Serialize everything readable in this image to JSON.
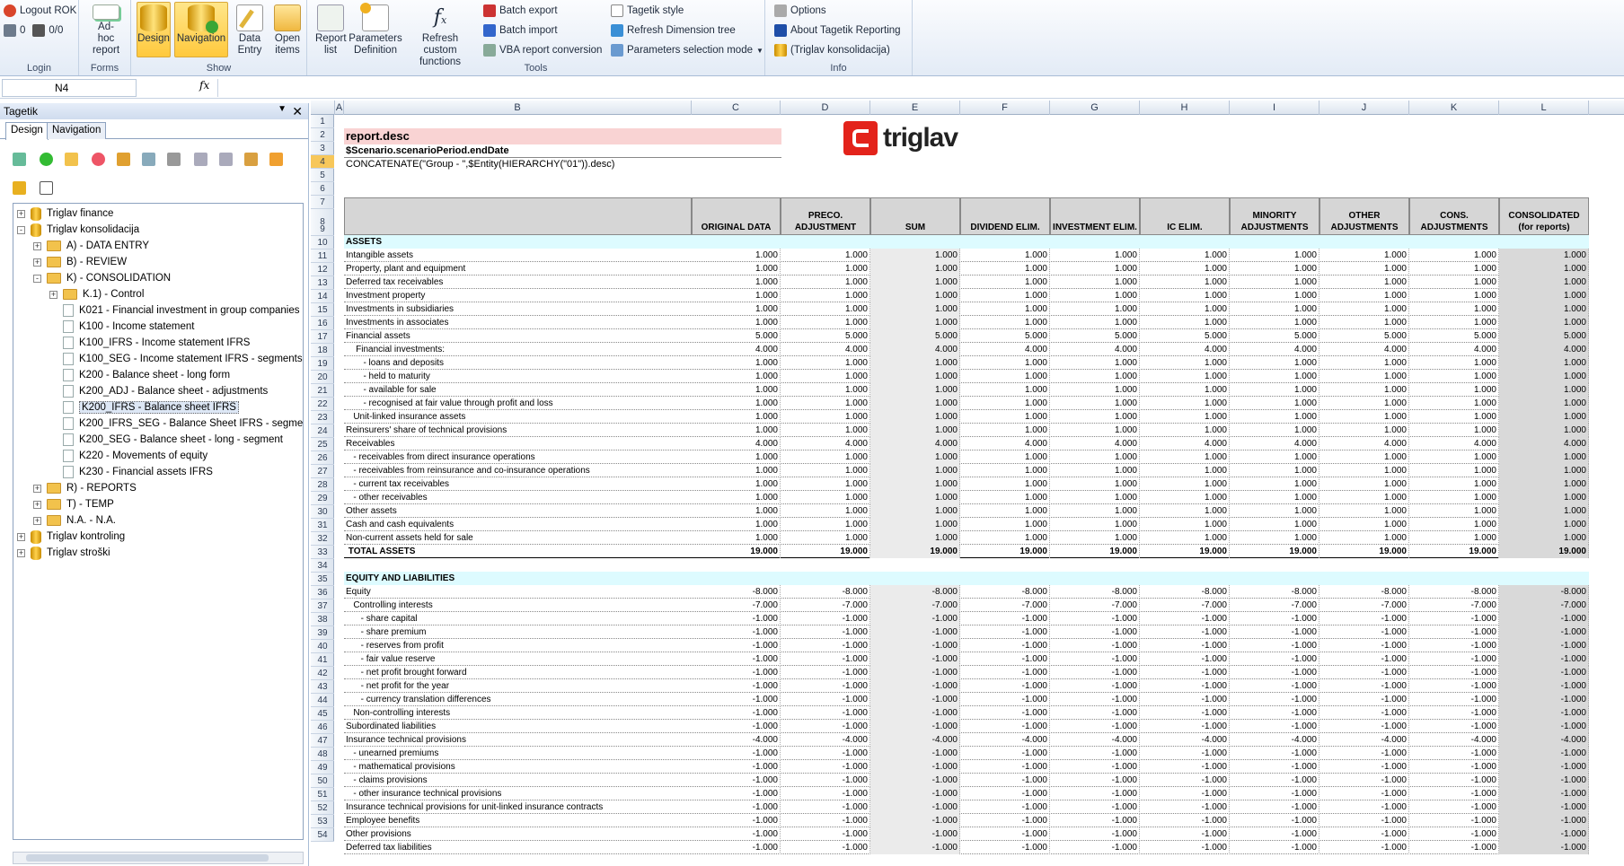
{
  "ribbon": {
    "login": {
      "logout": "Logout ROK",
      "count_a": "0",
      "count_b": "0/0",
      "label": "Login"
    },
    "forms": {
      "adhoc": "Ad-hoc report",
      "label": "Forms"
    },
    "show": {
      "design": "Design",
      "navigation": "Navigation",
      "data_entry": "Data Entry",
      "open_items": "Open items",
      "label": "Show"
    },
    "tools": {
      "report_list": "Report list",
      "params_def": "Parameters Definition",
      "refresh_custom": "Refresh custom functions",
      "batch_export": "Batch export",
      "batch_import": "Batch import",
      "vba": "VBA report conversion",
      "tagetik_style": "Tagetik style",
      "refresh_dim": "Refresh Dimension tree",
      "params_sel": "Parameters selection mode",
      "label": "Tools"
    },
    "info": {
      "options": "Options",
      "about": "About Tagetik Reporting",
      "db": "(Triglav konsolidacija)",
      "label": "Info"
    }
  },
  "formula": {
    "namebox": "N4",
    "fx": "fx",
    "value": ""
  },
  "pane": {
    "title": "Tagetik",
    "tabs": [
      "Design",
      "Navigation"
    ],
    "tree": [
      {
        "label": "Triglav finance",
        "lvl": 0,
        "type": "db",
        "exp": "+"
      },
      {
        "label": "Triglav konsolidacija",
        "lvl": 0,
        "type": "db",
        "exp": "-"
      },
      {
        "label": "A) - DATA ENTRY",
        "lvl": 1,
        "type": "folder",
        "exp": "+"
      },
      {
        "label": "B) - REVIEW",
        "lvl": 1,
        "type": "folder",
        "exp": "+"
      },
      {
        "label": "K) - CONSOLIDATION",
        "lvl": 1,
        "type": "folder",
        "exp": "-"
      },
      {
        "label": "K.1) - Control",
        "lvl": 2,
        "type": "folder",
        "exp": "+"
      },
      {
        "label": "K021 - Financial investment in group companies an",
        "lvl": 2,
        "type": "doc"
      },
      {
        "label": "K100 - Income statement",
        "lvl": 2,
        "type": "doc"
      },
      {
        "label": "K100_IFRS - Income statement IFRS",
        "lvl": 2,
        "type": "doc"
      },
      {
        "label": "K100_SEG - Income statement IFRS - segments",
        "lvl": 2,
        "type": "doc"
      },
      {
        "label": "K200 - Balance sheet - long form",
        "lvl": 2,
        "type": "doc"
      },
      {
        "label": "K200_ADJ - Balance sheet - adjustments",
        "lvl": 2,
        "type": "doc"
      },
      {
        "label": "K200_IFRS - Balance sheet IFRS",
        "lvl": 2,
        "type": "doc",
        "sel": true
      },
      {
        "label": "K200_IFRS_SEG - Balance Sheet IFRS - segment",
        "lvl": 2,
        "type": "doc"
      },
      {
        "label": "K200_SEG - Balance sheet - long - segment",
        "lvl": 2,
        "type": "doc"
      },
      {
        "label": "K220 - Movements of equity",
        "lvl": 2,
        "type": "doc"
      },
      {
        "label": "K230 - Financial assets IFRS",
        "lvl": 2,
        "type": "doc"
      },
      {
        "label": "R) - REPORTS",
        "lvl": 1,
        "type": "folder",
        "exp": "+"
      },
      {
        "label": "T) - TEMP",
        "lvl": 1,
        "type": "folder",
        "exp": "+"
      },
      {
        "label": "N.A. - N.A.",
        "lvl": 1,
        "type": "folder",
        "exp": "+"
      },
      {
        "label": "Triglav kontroling",
        "lvl": 0,
        "type": "db",
        "exp": "+"
      },
      {
        "label": "Triglav stroški",
        "lvl": 0,
        "type": "db",
        "exp": "+"
      }
    ]
  },
  "sheet": {
    "columns": [
      "A",
      "B",
      "C",
      "D",
      "E",
      "F",
      "G",
      "H",
      "I",
      "J",
      "K",
      "L"
    ],
    "title": "report.desc",
    "subtitle": "$Scenario.scenarioPeriod.endDate",
    "formula_row": "CONCATENATE(\"Group - \",$Entity(HIERARCHY(\"01\")).desc)",
    "logo": "triglav",
    "headers": [
      "ORIGINAL DATA",
      "PRECO. ADJUSTMENT",
      "SUM",
      "DIVIDEND ELIM.",
      "INVESTMENT ELIM.",
      "IC ELIM.",
      "MINORITY ADJUSTMENTS",
      "OTHER ADJUSTMENTS",
      "CONS. ADJUSTMENTS",
      "CONSOLIDATED (for reports)"
    ],
    "rows": [
      {
        "label": "ASSETS",
        "section": true
      },
      {
        "label": "Intangible assets",
        "v": "1.000"
      },
      {
        "label": "Property, plant and equipment",
        "v": "1.000"
      },
      {
        "label": "Deferred tax receivables",
        "v": "1.000"
      },
      {
        "label": "Investment property",
        "v": "1.000"
      },
      {
        "label": "Investments in subsidiaries",
        "v": "1.000"
      },
      {
        "label": "Investments in associates",
        "v": "1.000"
      },
      {
        "label": "Financial assets",
        "v": "5.000"
      },
      {
        "label": "    Financial investments:",
        "v": "4.000"
      },
      {
        "label": "       - loans and deposits",
        "v": "1.000"
      },
      {
        "label": "       - held to maturity",
        "v": "1.000"
      },
      {
        "label": "       - available for sale",
        "v": "1.000"
      },
      {
        "label": "       - recognised at fair value through profit and loss",
        "v": "1.000"
      },
      {
        "label": "   Unit-linked insurance assets",
        "v": "1.000"
      },
      {
        "label": "Reinsurers' share of technical provisions",
        "v": "1.000"
      },
      {
        "label": "Receivables",
        "v": "4.000"
      },
      {
        "label": "   - receivables from direct insurance operations",
        "v": "1.000"
      },
      {
        "label": "   - receivables from reinsurance and co-insurance operations",
        "v": "1.000"
      },
      {
        "label": "   - current tax receivables",
        "v": "1.000"
      },
      {
        "label": "   - other receivables",
        "v": "1.000"
      },
      {
        "label": "Other assets",
        "v": "1.000"
      },
      {
        "label": "Cash and cash equivalents",
        "v": "1.000"
      },
      {
        "label": "Non-current assets held for sale",
        "v": "1.000"
      },
      {
        "label": " TOTAL ASSETS",
        "v": "19.000",
        "bold": true
      },
      {
        "label": "",
        "blank": true
      },
      {
        "label": "EQUITY AND LIABILITIES",
        "section": true
      },
      {
        "label": "Equity",
        "v": "-8.000"
      },
      {
        "label": "   Controlling interests",
        "v": "-7.000"
      },
      {
        "label": "      - share capital",
        "v": "-1.000"
      },
      {
        "label": "      - share premium",
        "v": "-1.000"
      },
      {
        "label": "      - reserves from profit",
        "v": "-1.000"
      },
      {
        "label": "      - fair value reserve",
        "v": "-1.000"
      },
      {
        "label": "      - net profit brought forward",
        "v": "-1.000"
      },
      {
        "label": "      - net profit for the year",
        "v": "-1.000"
      },
      {
        "label": "      - currency translation differences",
        "v": "-1.000"
      },
      {
        "label": "   Non-controlling interests",
        "v": "-1.000"
      },
      {
        "label": "Subordinated liabilities",
        "v": "-1.000"
      },
      {
        "label": "Insurance technical provisions",
        "v": "-4.000"
      },
      {
        "label": "   - unearned premiums",
        "v": "-1.000"
      },
      {
        "label": "   - mathematical provisions",
        "v": "-1.000"
      },
      {
        "label": "   - claims provisions",
        "v": "-1.000"
      },
      {
        "label": "   - other insurance technical provisions",
        "v": "-1.000"
      },
      {
        "label": "Insurance technical provisions for unit-linked insurance contracts",
        "v": "-1.000"
      },
      {
        "label": "Employee benefits",
        "v": "-1.000"
      },
      {
        "label": "Other provisions",
        "v": "-1.000"
      },
      {
        "label": "Deferred tax liabilities",
        "v": "-1.000"
      }
    ]
  }
}
